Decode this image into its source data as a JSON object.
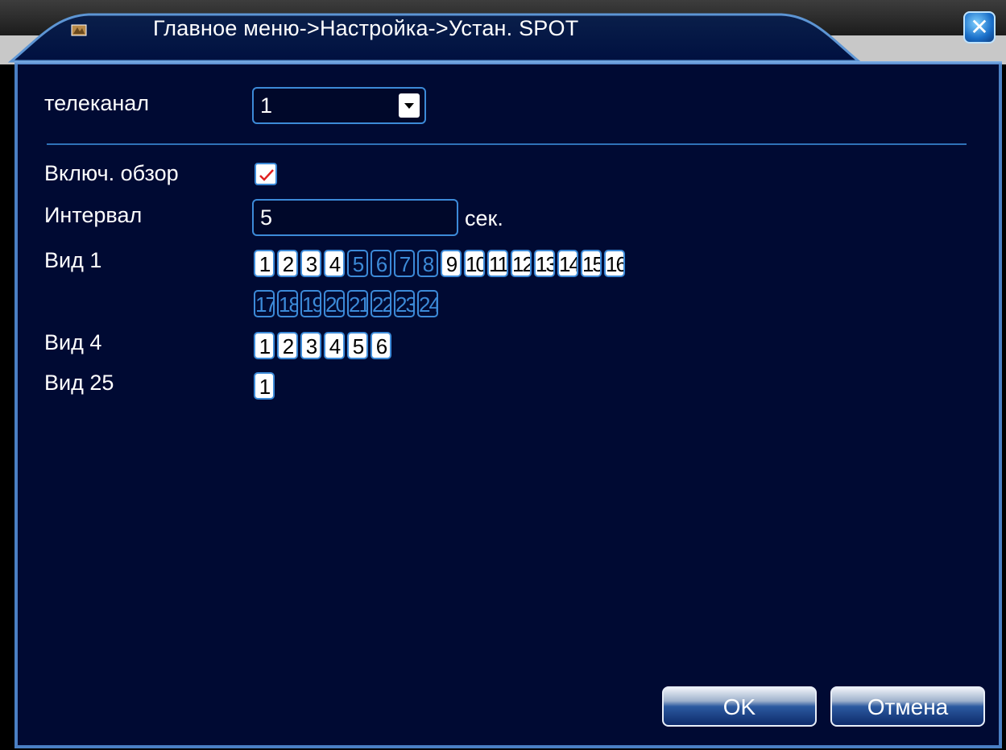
{
  "window": {
    "title": "Главное меню->Настройка->Устан. SPOT",
    "close_label": "✕"
  },
  "form": {
    "channel_label": "телеканал",
    "channel_value": "1",
    "tour_label": "Включ. обзор",
    "tour_enabled": true,
    "interval_label": "Интервал",
    "interval_value": "5",
    "interval_unit": "сек.",
    "view1_label": "Вид 1",
    "view4_label": "Вид 4",
    "view25_label": "Вид 25"
  },
  "view1_row1": [
    {
      "n": "1",
      "state": "on"
    },
    {
      "n": "2",
      "state": "on"
    },
    {
      "n": "3",
      "state": "on"
    },
    {
      "n": "4",
      "state": "on"
    },
    {
      "n": "5",
      "state": "off"
    },
    {
      "n": "6",
      "state": "off"
    },
    {
      "n": "7",
      "state": "off"
    },
    {
      "n": "8",
      "state": "off"
    },
    {
      "n": "9",
      "state": "on"
    },
    {
      "n": "10",
      "state": "on"
    },
    {
      "n": "11",
      "state": "on"
    },
    {
      "n": "12",
      "state": "on"
    },
    {
      "n": "13",
      "state": "on"
    },
    {
      "n": "14",
      "state": "on"
    },
    {
      "n": "15",
      "state": "on"
    },
    {
      "n": "16",
      "state": "on"
    }
  ],
  "view1_row2": [
    {
      "n": "17",
      "state": "off"
    },
    {
      "n": "18",
      "state": "off"
    },
    {
      "n": "19",
      "state": "off"
    },
    {
      "n": "20",
      "state": "off"
    },
    {
      "n": "21",
      "state": "off"
    },
    {
      "n": "22",
      "state": "off"
    },
    {
      "n": "23",
      "state": "off"
    },
    {
      "n": "24",
      "state": "off"
    }
  ],
  "view4": [
    {
      "n": "1",
      "state": "on"
    },
    {
      "n": "2",
      "state": "on"
    },
    {
      "n": "3",
      "state": "on"
    },
    {
      "n": "4",
      "state": "on"
    },
    {
      "n": "5",
      "state": "on"
    },
    {
      "n": "6",
      "state": "on"
    }
  ],
  "view25": [
    {
      "n": "1",
      "state": "on"
    }
  ],
  "buttons": {
    "ok": "OK",
    "cancel": "Отмена"
  },
  "colors": {
    "panel_bg": "#000a33",
    "accent": "#3c8ad8",
    "check_mark": "#e02020"
  }
}
